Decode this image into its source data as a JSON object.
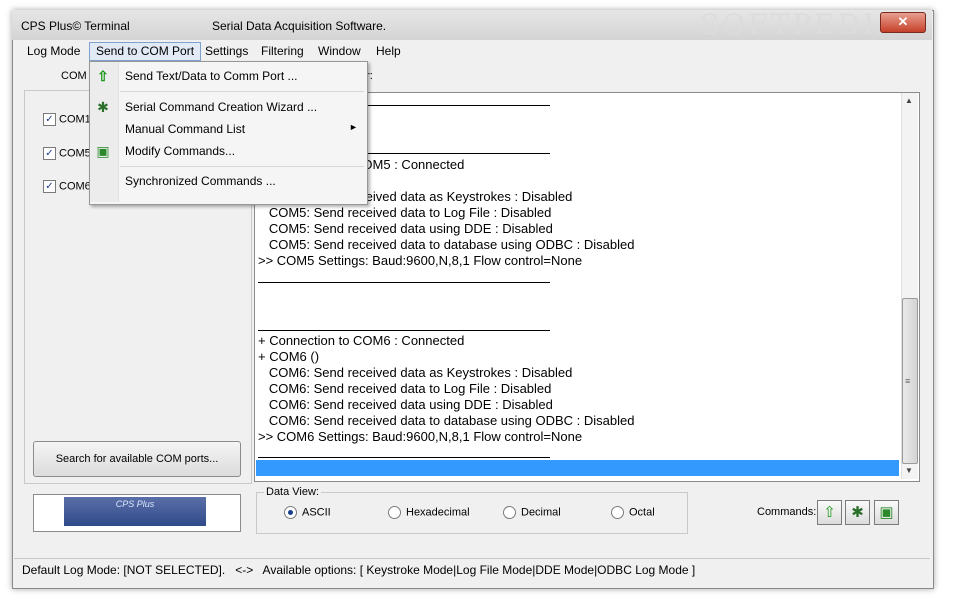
{
  "window": {
    "app_title": "CPS Plus© Terminal",
    "subtitle": "Serial Data Acquisition Software.",
    "watermark": "SOFTPEDIA",
    "close_label": "✕"
  },
  "menubar": {
    "items": [
      {
        "label": "Log Mode"
      },
      {
        "label": "Send to COM Port"
      },
      {
        "label": "Settings"
      },
      {
        "label": "Filtering"
      },
      {
        "label": "Window"
      },
      {
        "label": "Help"
      }
    ]
  },
  "dropdown": {
    "items": [
      {
        "label": "Send Text/Data to Comm Port ...",
        "icon": "green-up-arrow-icon"
      },
      {
        "label": "Serial Command Creation Wizard ...",
        "icon": "wizard-wand-icon"
      },
      {
        "label": "Manual Command List",
        "icon": "",
        "submenu": "►"
      },
      {
        "label": "Modify Commands...",
        "icon": "modify-commands-icon"
      },
      {
        "label": "Synchronized Commands ...",
        "icon": ""
      }
    ]
  },
  "tabs": {
    "left_label": "COM",
    "right_label": "or:"
  },
  "com_ports": [
    {
      "label": "COM1",
      "checked": true
    },
    {
      "label": "COM5",
      "checked": true
    },
    {
      "label": "COM6",
      "checked": true
    }
  ],
  "search_button": "Search for available COM ports...",
  "logo": {
    "text": "CPS Plus"
  },
  "log": {
    "lines": [
      "+ Connection to COM5 : Connected",
      "   COM5: Send received data as Keystrokes : Disabled",
      "   COM5: Send received data to Log File : Disabled",
      "   COM5: Send received data using DDE : Disabled",
      "   COM5: Send received data to database using ODBC : Disabled",
      ">> COM5 Settings: Baud:9600,N,8,1 Flow control=None",
      "+ Connection to COM6 : Connected",
      "+ COM6 ()",
      "   COM6: Send received data as Keystrokes : Disabled",
      "   COM6: Send received data to Log File : Disabled",
      "   COM6: Send received data using DDE : Disabled",
      "   COM6: Send received data to database using ODBC : Disabled",
      ">> COM6 Settings: Baud:9600,N,8,1 Flow control=None"
    ]
  },
  "data_view": {
    "label": "Data View:",
    "options": [
      {
        "label": "ASCII",
        "selected": true
      },
      {
        "label": "Hexadecimal",
        "selected": false
      },
      {
        "label": "Decimal",
        "selected": false
      },
      {
        "label": "Octal",
        "selected": false
      }
    ]
  },
  "commands": {
    "label": "Commands:",
    "buttons": [
      {
        "icon": "green-up-arrow-icon",
        "glyph": "⇧"
      },
      {
        "icon": "wizard-wand-icon",
        "glyph": "✱"
      },
      {
        "icon": "modify-commands-icon",
        "glyph": "▣"
      }
    ]
  },
  "status": {
    "text": "Default Log Mode: [NOT SELECTED].   <->   Available options: [ Keystroke Mode|Log File Mode|DDE Mode|ODBC Log Mode ]"
  },
  "scrollbar": {
    "up": "▲",
    "down": "▼",
    "grip": "≡"
  }
}
